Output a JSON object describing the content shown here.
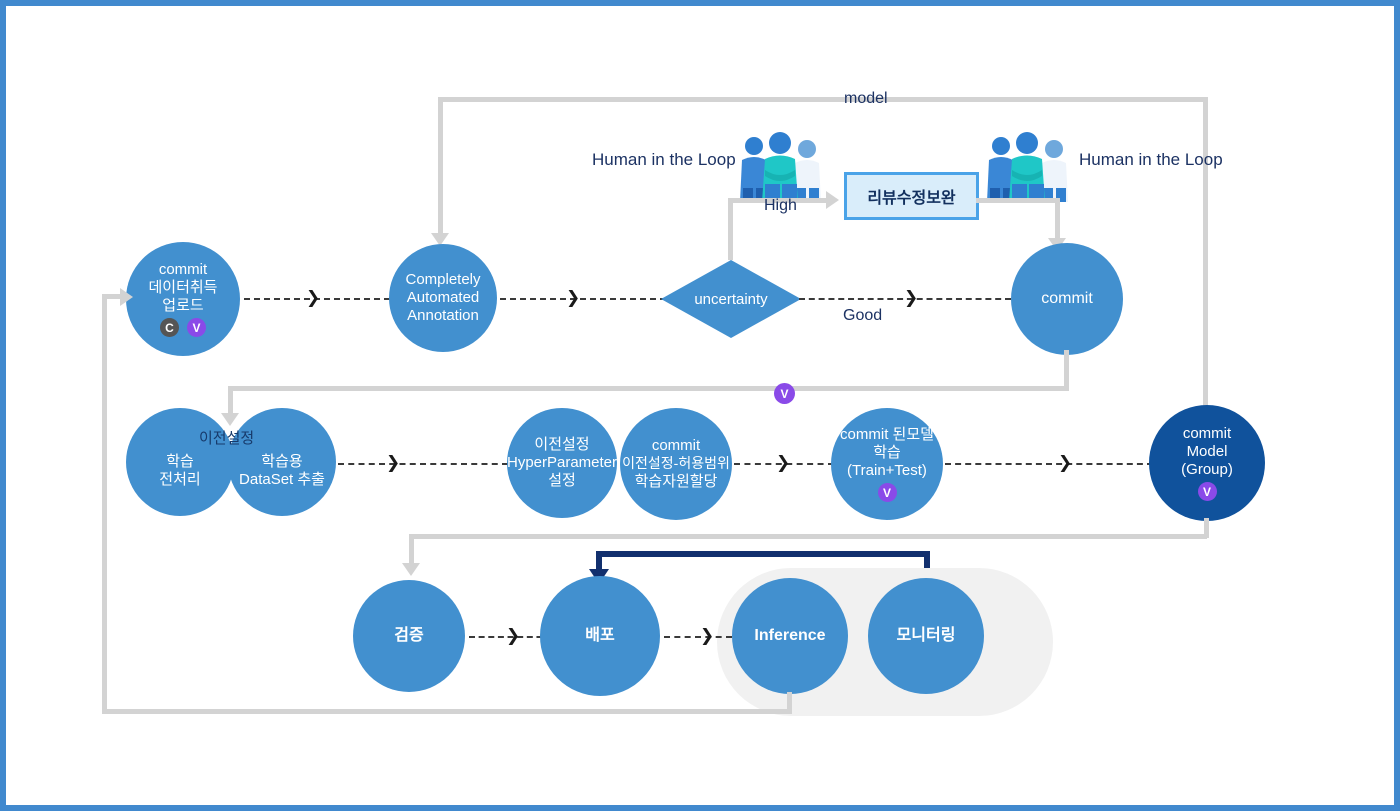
{
  "diagram": {
    "title": "MLOps lifecycle flow",
    "colors": {
      "frame_border": "#4189ce",
      "node_blue": "#4290cf",
      "node_dark_blue": "#10529c",
      "connector_gray": "#d3d3d3",
      "connector_navy": "#12306e",
      "badge_purple": "#8a4ae8",
      "badge_gray": "#555555",
      "review_box_fill": "#d9edfa",
      "review_box_border": "#4aa3e8",
      "group_pill": "#f1f1f1",
      "label_text": "#1c3263"
    }
  },
  "labels": {
    "model": "model",
    "human_in_the_loop_left": "Human in the Loop",
    "human_in_the_loop_right": "Human in the Loop",
    "high": "High",
    "good": "Good"
  },
  "badges": {
    "commit": "C",
    "version": "V"
  },
  "nodes": {
    "data_upload": {
      "name": "commit-data-upload",
      "lines": [
        "commit",
        "데이터취득",
        "업로드"
      ],
      "badges": [
        "C",
        "V"
      ]
    },
    "auto_annotation": {
      "name": "completely-automated-annotation",
      "lines": [
        "Completely",
        "Automated",
        "Annotation"
      ]
    },
    "uncertainty": {
      "name": "uncertainty-decision",
      "label": "uncertainty"
    },
    "review_box": {
      "name": "review-correction-box",
      "label": "리뷰수정보완"
    },
    "commit_review": {
      "name": "commit-after-review",
      "label": "commit"
    },
    "preprocess": {
      "name": "training-preprocess",
      "header": "이전설정",
      "lines": [
        "학습",
        "전처리"
      ]
    },
    "dataset_extract": {
      "name": "training-dataset-extract",
      "lines": [
        "학습용",
        "DataSet 추출"
      ]
    },
    "hyperparameter": {
      "name": "hyperparameter-setting",
      "lines": [
        "이전설정",
        "HyperParameter",
        "설정"
      ]
    },
    "resource_alloc": {
      "name": "commit-resource-allocation",
      "lines": [
        "commit",
        "이전설정-허용범위",
        "학습자원할당"
      ]
    },
    "train": {
      "name": "model-training",
      "lines": [
        "commit 된모델",
        "학습",
        "(Train+Test)"
      ],
      "badges": [
        "V"
      ]
    },
    "commit_model_group": {
      "name": "commit-model-group",
      "lines": [
        "commit",
        "Model",
        "(Group)"
      ],
      "badges": [
        "V"
      ]
    },
    "validate": {
      "name": "validation",
      "label": "검증"
    },
    "deploy": {
      "name": "deployment",
      "label": "배포"
    },
    "inference": {
      "name": "inference",
      "label": "Inference"
    },
    "monitoring": {
      "name": "monitoring",
      "label": "모니터링"
    }
  },
  "mid_badge": {
    "name": "version-badge-mid",
    "label": "V"
  }
}
